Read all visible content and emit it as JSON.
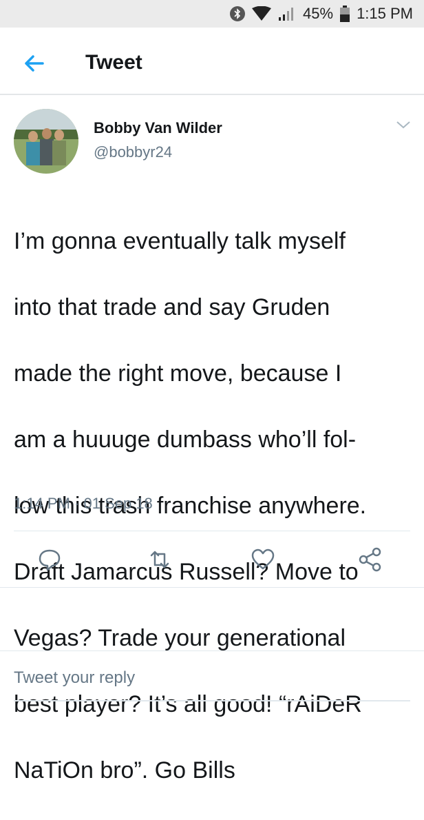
{
  "status_bar": {
    "battery": "45%",
    "time": "1:15 PM",
    "icons": [
      "bluetooth-icon",
      "wifi-icon",
      "signal-icon",
      "battery-icon"
    ]
  },
  "app_bar": {
    "title": "Tweet",
    "back_icon": "arrow-left-icon",
    "accent_color": "#1da1f2"
  },
  "tweet": {
    "author_name": "Bobby Van Wilder",
    "author_handle": "@bobbyr24",
    "text_lines": [
      "I’m gonna eventually talk myself",
      "into that trade and say Gruden",
      "made the right move, because I",
      "am a huuuge dumbass who’ll fol-",
      "low this trash franchise anywhere.",
      "Draft Jamarcus Russell? Move to",
      "Vegas? Trade your generational",
      "best player? It’s all good! “rAiDeR",
      "NaTiOn bro”. Go Bills"
    ],
    "timestamp": "1:14 PM · 01 Sep 18"
  },
  "actions": [
    "reply-icon",
    "retweet-icon",
    "like-icon",
    "share-icon"
  ],
  "reply": {
    "placeholder": "Tweet your reply"
  }
}
